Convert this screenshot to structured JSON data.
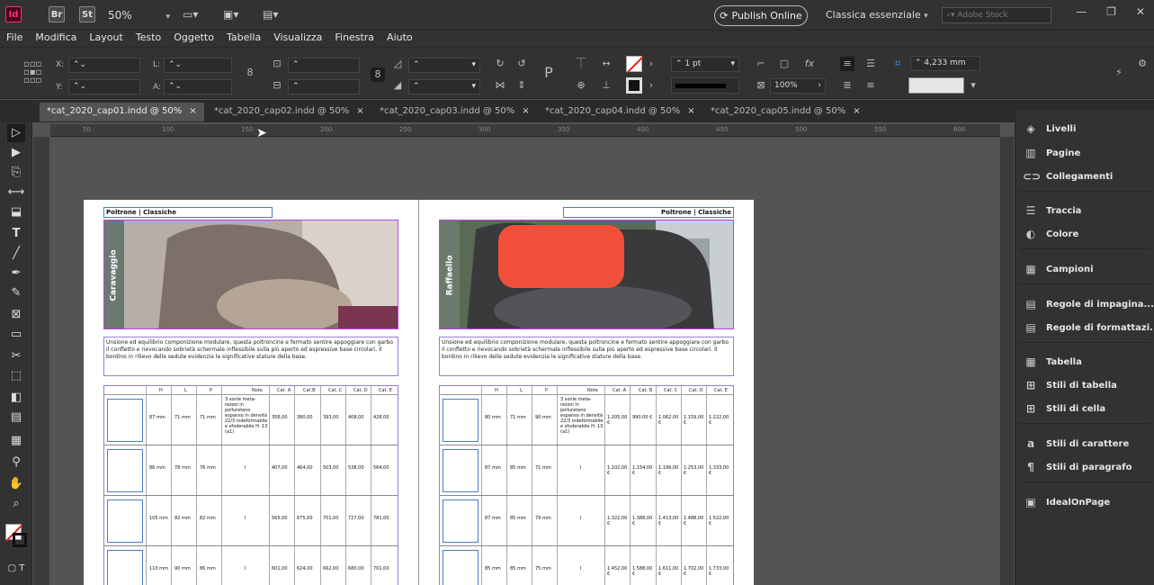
{
  "appbar": {
    "app_icons": [
      "Id",
      "Br",
      "St"
    ],
    "zoom": "50%",
    "publish": "Publish Online",
    "workspace": "Classica essenziale",
    "search_placeholder": "Adobe Stock"
  },
  "menu": [
    "File",
    "Modifica",
    "Layout",
    "Testo",
    "Oggetto",
    "Tabella",
    "Visualizza",
    "Finestra",
    "Aiuto"
  ],
  "control": {
    "x_label": "X:",
    "y_label": "Y:",
    "w_label": "L:",
    "h_label": "A:",
    "stroke_weight": "1 pt",
    "zoom_scale": "100%",
    "dimension": "4,233 mm",
    "icons": [
      "reference-point",
      "link-proportions",
      "rotate",
      "shear",
      "flip",
      "fill",
      "stroke",
      "effects",
      "fitting"
    ]
  },
  "tabs": [
    {
      "label": "*cat_2020_cap01.indd @ 50%",
      "close": "×",
      "active": true
    },
    {
      "label": "*cat_2020_cap02.indd @ 50%",
      "close": "×",
      "active": false
    },
    {
      "label": "*cat_2020_cap03.indd @ 50%",
      "close": "×",
      "active": false
    },
    {
      "label": "*cat_2020_cap04.indd @ 50%",
      "close": "×",
      "active": false
    },
    {
      "label": "*cat_2020_cap05.indd @ 50%",
      "close": "×",
      "active": false
    }
  ],
  "ruler_ticks": [
    "50",
    "100",
    "150",
    "200",
    "250",
    "300",
    "350",
    "400",
    "450",
    "500",
    "550",
    "600",
    "650"
  ],
  "pages": {
    "left": {
      "header": "Poltrone | Classiche",
      "label": "Caravaggio",
      "text": "Unsione ed equilibrio componizione modulare, questa poltroncine e fermato sentire appoggiare con garbo il confletto e rievocando sobrietà schermale inflessibile sulla più aperto ed espressive base circolari. Il bordino in rilievo delle sedute evidenzia le significative stature della base.",
      "columns": [
        "H",
        "L",
        "P",
        "Note",
        "Cat. A",
        "Cat.B",
        "Cat. C",
        "Cat. D",
        "Cat. E"
      ],
      "rows": [
        {
          "h": "87 mm",
          "l": "71 mm",
          "p": "71 mm",
          "note": "3 sonle meta-rezzoi in polluretano espanso in densità 22/3 indeformabile e sfoderabile H. 13 (a1)",
          "a": "356,00",
          "b": "380,00",
          "c": "393,00",
          "d": "408,00",
          "e": "428,00"
        },
        {
          "h": "86 mm",
          "l": "78 mm",
          "p": "76 mm",
          "note": "I",
          "a": "407,00",
          "b": "464,00",
          "c": "503,00",
          "d": "538,00",
          "e": "564,00"
        },
        {
          "h": "105 mm",
          "l": "82 mm",
          "p": "82 mm",
          "note": "I",
          "a": "565,00",
          "b": "675,00",
          "c": "701,00",
          "d": "727,00",
          "e": "781,00"
        },
        {
          "h": "110 mm",
          "l": "90 mm",
          "p": "86 mm",
          "note": "I",
          "a": "601,00",
          "b": "624,00",
          "c": "662,00",
          "d": "680,00",
          "e": "701,00"
        }
      ]
    },
    "right": {
      "header": "Poltrone | Classiche",
      "label": "Raffaello",
      "text": "Unsione ed equilibrio componizione modulare, questa poltroncine e fermato sentire appoggiare con garbo il confletto e rievocando sobrietà schermale inflessibile sulla più aperto ed espressive base circolari. Il bordino in rilievo delle sedute evidenzia le significative stature della base.",
      "columns": [
        "H",
        "L",
        "P",
        "Note",
        "Cat. A",
        "Cat. B",
        "Cat. C",
        "Cat. D",
        "Cat. E"
      ],
      "rows": [
        {
          "h": "80 mm",
          "l": "71 mm",
          "p": "90 mm",
          "note": "3 sonle meta-rezzoi in polluretano espanso in densità 22/3 indeformabile e sfoderabile H. 13 (a1)",
          "a": "1.205,00 €",
          "b": "990,00 €",
          "c": "1.062,00 €",
          "d": "1.159,00 €",
          "e": "1.222,00 €"
        },
        {
          "h": "87 mm",
          "l": "85 mm",
          "p": "71 mm",
          "note": "I",
          "a": "1.102,00 €",
          "b": "1.154,00 €",
          "c": "1.199,00 €",
          "d": "1.253,00 €",
          "e": "1.333,00 €"
        },
        {
          "h": "87 mm",
          "l": "85 mm",
          "p": "79 mm",
          "note": "I",
          "a": "1.322,00 €",
          "b": "1.388,00 €",
          "c": "1.413,00 €",
          "d": "1.488,00 €",
          "e": "1.522,00 €"
        },
        {
          "h": "85 mm",
          "l": "85 mm",
          "p": "75 mm",
          "note": "I",
          "a": "1.452,00 €",
          "b": "1.588,00 €",
          "c": "1.611,00 €",
          "d": "1.702,00 €",
          "e": "1.733,00 €"
        }
      ]
    }
  },
  "panels": [
    {
      "label": "Livelli",
      "icon": "layers-icon"
    },
    {
      "label": "Pagine",
      "icon": "pages-icon"
    },
    {
      "label": "Collegamenti",
      "icon": "links-icon"
    },
    {
      "label": "Traccia",
      "icon": "stroke-icon"
    },
    {
      "label": "Colore",
      "icon": "color-icon"
    },
    {
      "label": "Campioni",
      "icon": "swatches-icon"
    },
    {
      "label": "Regole di impagina...",
      "icon": "layout-rules-icon"
    },
    {
      "label": "Regole di formattazi...",
      "icon": "format-rules-icon"
    },
    {
      "label": "Tabella",
      "icon": "table-icon"
    },
    {
      "label": "Stili di tabella",
      "icon": "table-styles-icon"
    },
    {
      "label": "Stili di cella",
      "icon": "cell-styles-icon"
    },
    {
      "label": "Stili di carattere",
      "icon": "char-styles-icon"
    },
    {
      "label": "Stili di paragrafo",
      "icon": "para-styles-icon"
    },
    {
      "label": "IdealOnPage",
      "icon": "plugin-icon"
    }
  ],
  "colors": {
    "accent": "#c040e0",
    "frame": "#4a7cc2",
    "chrome": "#323232",
    "pasteboard": "#545454"
  }
}
